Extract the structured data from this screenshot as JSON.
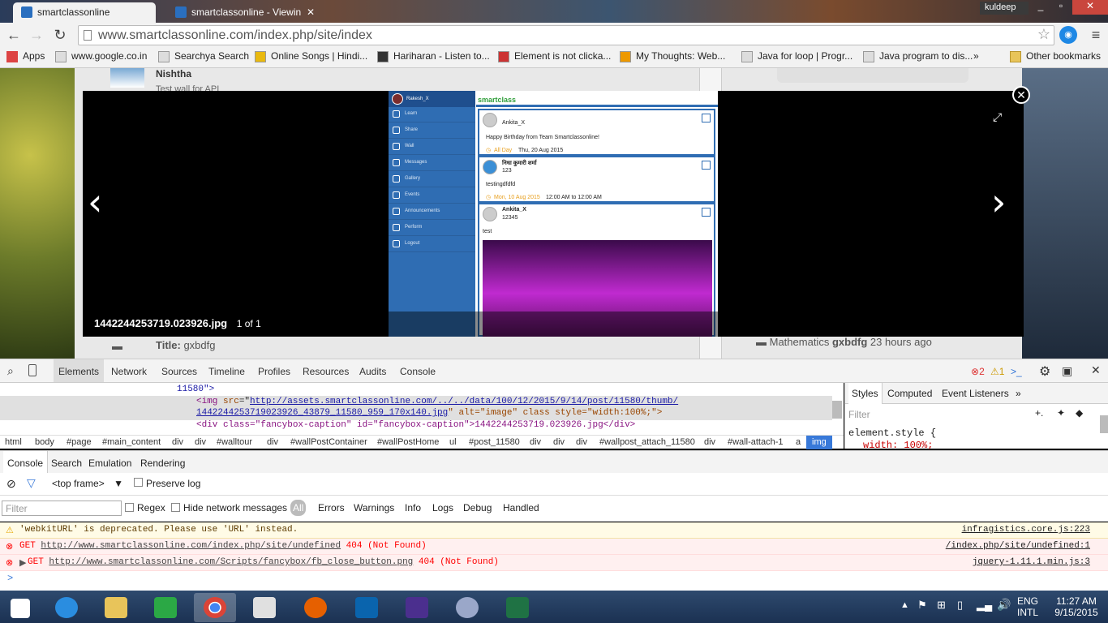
{
  "browser": {
    "tabs": [
      {
        "title": "smartclassonline",
        "active": true
      },
      {
        "title": "smartclassonline - Viewin",
        "active": false
      }
    ],
    "user": "kuldeep",
    "url": "www.smartclassonline.com/index.php/site/index",
    "bookmarks": [
      "Apps",
      "www.google.co.in",
      "Searchya Search",
      "Online Songs | Hindi...",
      "Hariharan - Listen to...",
      "Element is not clicka...",
      "My Thoughts: Web...",
      "Java for loop | Progr...",
      "Java program to dis..."
    ],
    "overflow": "»",
    "other_bookmarks": "Other bookmarks"
  },
  "page": {
    "wall_author": "Nishtha",
    "wall_text": "Test wall for API",
    "title_label": "Title:",
    "title_value": "gxbdfg",
    "activity": {
      "subject": "Mathematics",
      "name": "gxbdfg",
      "time": "23 hours ago"
    }
  },
  "lightbox": {
    "caption": "1442244253719.023926.jpg",
    "counter": "1 of 1",
    "prev": "‹",
    "next": "›",
    "close": "✕",
    "expand": "⤢",
    "app": {
      "user": "Rakesh_X",
      "logo": "smartclass",
      "nav": [
        "Learn",
        "Share",
        "Wall",
        "Messages",
        "Gallery",
        "Events",
        "Announcements",
        "Perform",
        "Logout"
      ],
      "posts": [
        {
          "author": "Ankita_X",
          "sub": "",
          "text": "Happy Birthday from Team Smartclassonline!",
          "date_tag": "All Day",
          "date": "Thu, 20 Aug 2015"
        },
        {
          "author": "निधा कुमारी शर्मा",
          "sub": "123",
          "text": "testingdfdfd",
          "date_tag": "Mon, 10 Aug 2015",
          "date": "12:00 AM to 12:00 AM"
        },
        {
          "author": "Ankita_X",
          "sub": "12345",
          "text": "test",
          "date_tag": "",
          "date": ""
        }
      ]
    }
  },
  "devtools": {
    "tabs": [
      "Elements",
      "Network",
      "Sources",
      "Timeline",
      "Profiles",
      "Resources",
      "Audits",
      "Console"
    ],
    "error_count": "2",
    "warning_count": "1",
    "code": {
      "line1": "11580\">",
      "img_src_1": "http://assets.smartclassonline.com/../../data/100/12/2015/9/14/post/11580/thumb/",
      "img_src_2": "1442244253719023926_43879_11580_959_170x140.jpg",
      "img_rest": "\" alt=\"image\" class style=\"width:100%;\">",
      "div_line": "<div class=\"fancybox-caption\" id=\"fancybox-caption\">1442244253719.023926.jpg</div>"
    },
    "breadcrumbs": [
      "html",
      "body",
      "#page",
      "#main_content",
      "div",
      "div",
      "#walltour",
      "div",
      "#wallPostContainer",
      "#wallPostHome",
      "ul",
      "#post_11580",
      "div",
      "div",
      "div",
      "#wallpost_attach_11580",
      "div",
      "#wall-attach-1",
      "a",
      "img"
    ],
    "styles_tabs": [
      "Styles",
      "Computed",
      "Event Listeners",
      "»"
    ],
    "styles_filter": "Filter",
    "element_style": "element.style {",
    "style_rule": "width: 100%;",
    "console_tabs": [
      "Console",
      "Search",
      "Emulation",
      "Rendering"
    ],
    "frame": "<top frame>",
    "preserve_log": "Preserve log",
    "filter_placeholder": "Filter",
    "regex": "Regex",
    "hide_network": "Hide network messages",
    "levels": [
      "All",
      "Errors",
      "Warnings",
      "Info",
      "Logs",
      "Debug",
      "Handled"
    ],
    "messages": [
      {
        "type": "warning",
        "text": "'webkitURL' is deprecated. Please use 'URL' instead.",
        "source": "infragistics.core.js:223"
      },
      {
        "type": "error",
        "text_prefix": "GET ",
        "link": "http://www.smartclassonline.com/index.php/site/undefined",
        "text_suffix": " 404 (Not Found)",
        "source": "/index.php/site/undefined:1"
      },
      {
        "type": "error",
        "text_prefix": "GET ",
        "link": "http://www.smartclassonline.com/Scripts/fancybox/fb_close_button.png",
        "text_suffix": " 404 (Not Found)",
        "source": "jquery-1.11.1.min.js:3"
      }
    ],
    "prompt": ">"
  },
  "taskbar": {
    "lang": [
      "ENG",
      "INTL"
    ],
    "time": "11:27 AM",
    "date": "9/15/2015"
  }
}
